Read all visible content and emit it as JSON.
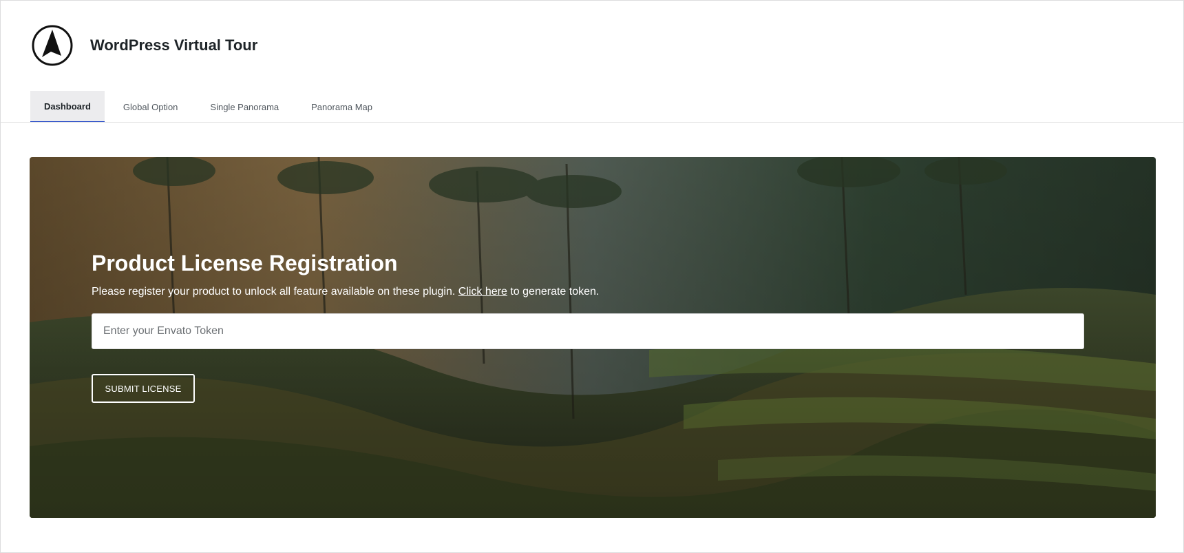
{
  "app": {
    "title": "WordPress Virtual Tour",
    "logo_icon": "navigation-arrow-icon"
  },
  "tabs": [
    {
      "label": "Dashboard",
      "active": true
    },
    {
      "label": "Global Option",
      "active": false
    },
    {
      "label": "Single Panorama",
      "active": false
    },
    {
      "label": "Panorama Map",
      "active": false
    }
  ],
  "license": {
    "title": "Product License Registration",
    "desc_before": "Please register your product to unlock all feature available on these plugin. ",
    "link_text": "Click here",
    "desc_after": " to generate token.",
    "token_placeholder": "Enter your Envato Token",
    "token_value": "",
    "submit_label": "SUBMIT LICENSE"
  },
  "colors": {
    "accent": "#2f52c9",
    "tab_active_bg": "#ececee"
  }
}
